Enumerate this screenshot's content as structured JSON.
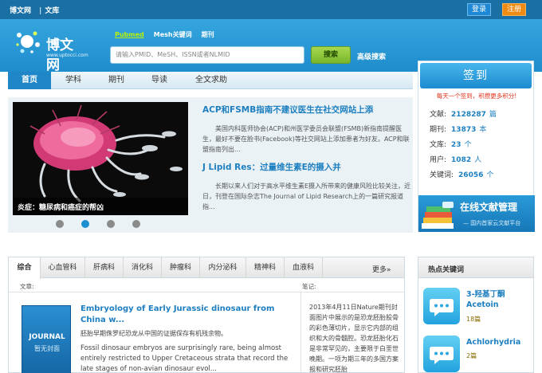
{
  "topbar": {
    "links": [
      "博文网",
      "文库"
    ],
    "login": "登录",
    "register": "注册"
  },
  "header": {
    "logo_text": "博文网",
    "logo_sub": "www.uptocci.com",
    "search_tabs": [
      "Pubmed",
      "Mesh关键词",
      "期刊"
    ],
    "search_placeholder": "请输入PMID、MeSH、ISSN或者NLMID",
    "search_button": "搜索",
    "advanced_search": "高级搜索"
  },
  "nav": {
    "items": [
      "首页",
      "学科",
      "期刊",
      "导读",
      "全文求助"
    ]
  },
  "slider": {
    "caption": "炎症：糖尿病和癌症的帮凶",
    "dot_count": 4,
    "active_dot": 1,
    "articles": [
      {
        "title": "ACP和FSMB指南不建议医生在社交网站上添",
        "body": "美国内科医师协会(ACP)和州医学委员会联盟(FSMB)新指南提醒医生，最好不要在脸书(Facebook)等社交网站上添加患者为好友。ACP和联盟指南列出..."
      },
      {
        "title": "J Lipid Res：过量维生素E的摄入并",
        "body": "长期以来人们对于高水平维生素E摄入所带来的健康风险比较关注，近日，刊登在国际杂志The Journal of Lipid Research上的一篇研究报道指..."
      }
    ]
  },
  "sidebar": {
    "signin_button": "签到",
    "signin_tip": "每天一个签到，积攒更多积分!",
    "stats": [
      {
        "label": "文献:",
        "value": "2128287",
        "unit": "篇"
      },
      {
        "label": "期刊:",
        "value": "13873",
        "unit": "本"
      },
      {
        "label": "文库:",
        "value": "23",
        "unit": "个"
      },
      {
        "label": "用户:",
        "value": "1082",
        "unit": "人"
      },
      {
        "label": "关键词:",
        "value": "26056",
        "unit": "个"
      }
    ],
    "promo_title": "在线文献管理",
    "promo_sub": "— 国内首家云文献平台"
  },
  "categories": {
    "tabs": [
      "综合",
      "心血管科",
      "肝病科",
      "消化科",
      "肿瘤科",
      "内分泌科",
      "精神科",
      "血液科"
    ],
    "more": "更多»",
    "col_article": "文章:",
    "col_notes": "笔记:",
    "card": {
      "journal_title": "JOURNAL",
      "journal_sub": "暂无封面",
      "title": "Embryology of Early Jurassic dinosaur from China w...",
      "subtitle": "胚胎早期侏罗纪恐龙从中国的证据保存有机残余物。",
      "body": "Fossil dinosaur embryos are surprisingly rare, being almost entirely restricted to Upper Cretaceous strata that record the late stages of non-avian dinosaur evol..."
    },
    "notes": "2013年4月11日Nature期刊封面图片中展示的是恐龙胚胎股骨的彩色薄切片，显示它内部的组织和大的骨髓腔。恐龙胚胎化石是非常罕见的，主要限于白垩世晚期。一项为期三年的多国方案报和研究胚胎"
  },
  "hot_keywords": {
    "title": "热点关键词",
    "items": [
      {
        "name": "3-羟基丁酮 Acetoin",
        "count": "18篇"
      },
      {
        "name": "Achlorhydria",
        "count": "2篇"
      }
    ]
  },
  "colors": {
    "brand_blue": "#1d7fc0",
    "header_blue": "#2a9bd7",
    "orange": "#f08b12",
    "green": "#78b52b",
    "red_tip": "#e2321c"
  }
}
